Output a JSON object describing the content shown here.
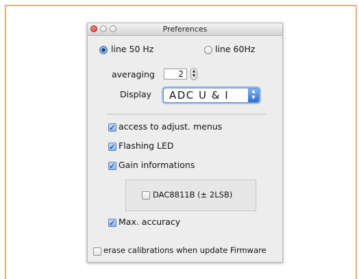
{
  "window": {
    "title": "Preferences"
  },
  "mains": {
    "option_50": "line 50 Hz",
    "option_60": "line 60Hz",
    "selected": "line 50 Hz"
  },
  "averaging": {
    "label": "averaging",
    "value": "2"
  },
  "display": {
    "label": "Display",
    "value": "ADC U & I"
  },
  "checkboxes": {
    "adjust_menus": {
      "label": "access to adjust. menus",
      "checked": true
    },
    "flashing_led": {
      "label": "Flashing LED",
      "checked": true
    },
    "gain_info": {
      "label": "Gain informations",
      "checked": true
    },
    "dac": {
      "label": "DAC8811B (± 2LSB)",
      "checked": false
    },
    "max_accuracy": {
      "label": "Max. accuracy",
      "checked": true
    },
    "erase_calib": {
      "label": "erase calibrations when update Firmware",
      "checked": false
    }
  },
  "colors": {
    "frame_border": "#f0ad78",
    "accent": "#2f6fd4",
    "window_bg": "#ededed"
  }
}
